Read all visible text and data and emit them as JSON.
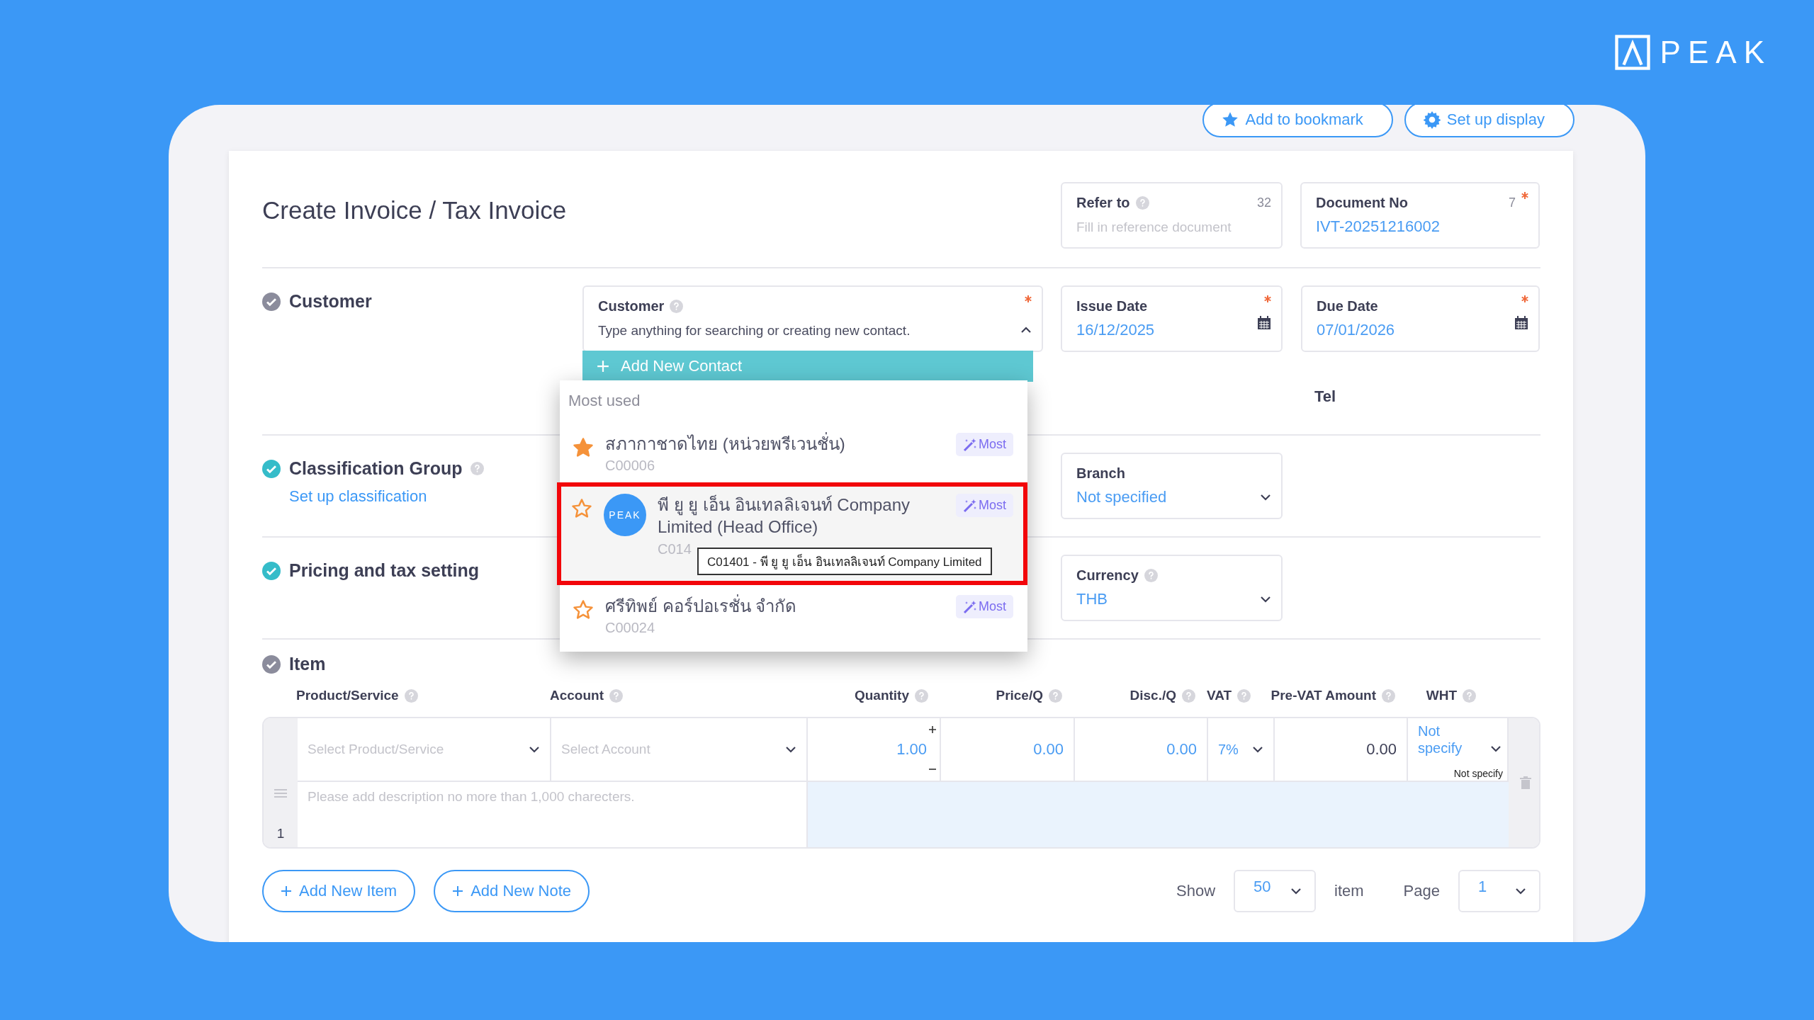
{
  "logo": {
    "text": "PEAK"
  },
  "toolbar": [
    {
      "label": "Add to bookmark"
    },
    {
      "label": "Set up display"
    }
  ],
  "title": "Create Invoice / Tax Invoice",
  "refer_to": {
    "label": "Refer to",
    "counter": "32",
    "placeholder": "Fill in reference document",
    "help": true
  },
  "document_no": {
    "label": "Document No",
    "counter": "7",
    "value": "IVT-20251216002",
    "required": true
  },
  "sections": [
    {
      "title": "Customer",
      "done": false
    },
    {
      "title": "Classification Group",
      "done": true,
      "help": true,
      "link": "Set up classification"
    },
    {
      "title": "Pricing and tax setting",
      "done": true
    },
    {
      "title": "Item",
      "done": false
    }
  ],
  "customer": {
    "label": "Customer",
    "placeholder": "Type anything for searching or creating new contact.",
    "required": true,
    "help": true,
    "expanded": true
  },
  "contact_dropdown": {
    "add_label": "Add New Contact",
    "group": "Most used",
    "items": [
      {
        "name": "สภากาชาดไทย (หน่วยพรีเวนชั่น)",
        "code": "C00006",
        "favorite": true,
        "badge": "Most",
        "selected": false
      },
      {
        "name": "พี ยู ยู เอ็น อินเทลลิเจนท์ Company Limited (Head Office)",
        "code": "C014",
        "favorite": false,
        "badge": "Most",
        "selected": true,
        "avatar": "PEAK",
        "tooltip": "C01401 - พี ยู ยู เอ็น อินเทลลิเจนท์ Company Limited"
      },
      {
        "name": "ศรีทิพย์ คอร์ปอเรชั่น จำกัด",
        "code": "C00024",
        "favorite": false,
        "badge": "Most",
        "selected": false
      }
    ]
  },
  "issue_date": {
    "label": "Issue Date",
    "value": "16/12/2025",
    "required": true
  },
  "due_date": {
    "label": "Due Date",
    "value": "07/01/2026",
    "required": true
  },
  "tel_label": "Tel",
  "branch": {
    "label": "Branch",
    "value": "Not specified"
  },
  "currency": {
    "label": "Currency",
    "value": "THB",
    "help": true
  },
  "item_table": {
    "columns": [
      {
        "label": "Product/Service"
      },
      {
        "label": "Account"
      },
      {
        "label": "Quantity"
      },
      {
        "label": "Price/Q"
      },
      {
        "label": "Disc./Q"
      },
      {
        "label": "VAT"
      },
      {
        "label": "Pre-VAT Amount"
      },
      {
        "label": "WHT"
      }
    ],
    "rows": [
      {
        "number": "1",
        "product_placeholder": "Select Product/Service",
        "account_placeholder": "Select Account",
        "quantity": "1.00",
        "price": "0.00",
        "discount": "0.00",
        "vat": "7%",
        "pre_vat_amount": "0.00",
        "wht": "Not specify",
        "wht_hint": "Not specify",
        "description_placeholder": "Please add description no more than 1,000 charecters."
      }
    ]
  },
  "footer": {
    "buttons": [
      "Add New Item",
      "Add New Note"
    ],
    "show_label": "Show",
    "page_size": "50",
    "item_label": "item",
    "page_label": "Page",
    "page": "1"
  }
}
